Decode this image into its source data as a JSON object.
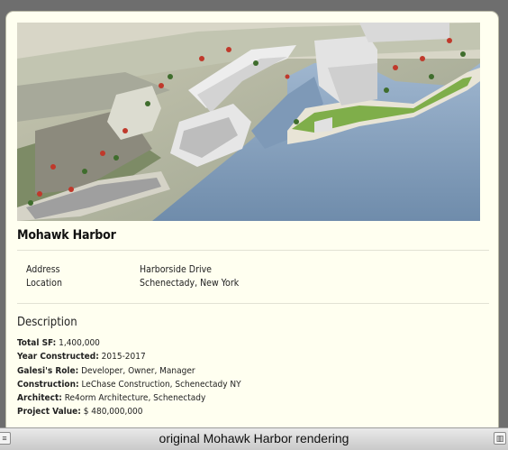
{
  "listing": {
    "photo_alt": "original Mohawk Harbor rendering",
    "title": "Mohawk Harbor",
    "info": [
      {
        "label": "Address",
        "value": "Harborside Drive"
      },
      {
        "label": "Location",
        "value": "Schenectady, New York"
      }
    ],
    "description_title": "Description",
    "facts": [
      {
        "label": "Total SF:",
        "value": "1,400,000"
      },
      {
        "label": "Year Constructed:",
        "value": "2015-2017"
      },
      {
        "label": "Galesi's Role:",
        "value": "Developer, Owner, Manager"
      },
      {
        "label": "Construction:",
        "value": "LeChase Construction, Schenectady NY"
      },
      {
        "label": "Architect:",
        "value": "Re4orm Architecture, Schenectady"
      },
      {
        "label": "Project Value:",
        "value": "$ 480,000,000"
      }
    ]
  },
  "statusbar": {
    "caption": "original Mohawk Harbor rendering"
  },
  "colors": {
    "card_background": "#fffff0",
    "water": "#7f9ab8",
    "window_background": "#6e6e6e"
  }
}
